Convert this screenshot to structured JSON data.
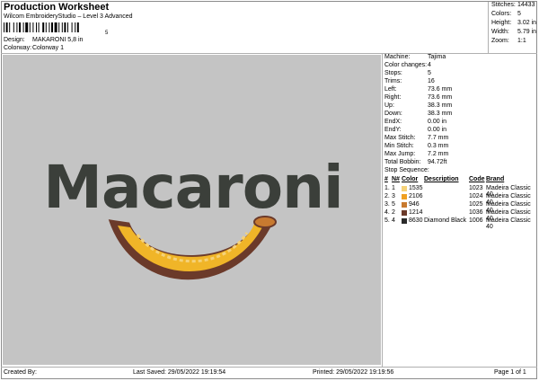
{
  "header": {
    "title": "Production Worksheet",
    "software": "Wilcom EmbroideryStudio – Level 3 Advanced",
    "barcode_digit": "5",
    "design_label": "Design:",
    "design_value": "MAKARONI 5,8 in",
    "colorway_label": "Colorway:",
    "colorway_value": "Colorway 1"
  },
  "stats": [
    {
      "label": "Stitches:",
      "value": "14433"
    },
    {
      "label": "Colors:",
      "value": "5"
    },
    {
      "label": "Height:",
      "value": "3.02 in"
    },
    {
      "label": "Width:",
      "value": "5.79 in"
    },
    {
      "label": "Zoom:",
      "value": "1:1"
    }
  ],
  "design_preview": {
    "text": "Macaroni",
    "text_color": "#3b3f3a",
    "background": "#c4c4c4",
    "pasta_color": "#f0b528",
    "outline_color": "#6b3a2a"
  },
  "machine_info": [
    {
      "label": "Machine:",
      "value": "Tajima"
    },
    {
      "label": "Color changes:",
      "value": "4"
    },
    {
      "label": "Stops:",
      "value": "5"
    },
    {
      "label": "Trims:",
      "value": "16"
    },
    {
      "label": "Left:",
      "value": "73.6 mm"
    },
    {
      "label": "Right:",
      "value": "73.6 mm"
    },
    {
      "label": "Up:",
      "value": "38.3 mm"
    },
    {
      "label": "Down:",
      "value": "38.3 mm"
    },
    {
      "label": "EndX:",
      "value": "0.00 in"
    },
    {
      "label": "EndY:",
      "value": "0.00 in"
    },
    {
      "label": "Max Stitch:",
      "value": "7.7 mm"
    },
    {
      "label": "Min Stitch:",
      "value": "0.3 mm"
    },
    {
      "label": "Max Jump:",
      "value": "7.2 mm"
    },
    {
      "label": "Total Bobbin:",
      "value": "94.72ft"
    }
  ],
  "stop_sequence": {
    "title": "Stop Sequence:",
    "headers": {
      "num": "#",
      "needle": "N#",
      "color": "Color",
      "description": "Description",
      "code": "Code",
      "brand": "Brand"
    },
    "rows": [
      {
        "num": "1.",
        "needle": "1",
        "swatch": "#f5d27a",
        "color": "1535",
        "description": "",
        "code": "1023",
        "brand": "Madeira Classic 40"
      },
      {
        "num": "2.",
        "needle": "3",
        "swatch": "#f0a020",
        "color": "2106",
        "description": "",
        "code": "1024",
        "brand": "Madeira Classic 40"
      },
      {
        "num": "3.",
        "needle": "5",
        "swatch": "#c87a30",
        "color": "946",
        "description": "",
        "code": "1025",
        "brand": "Madeira Classic 40"
      },
      {
        "num": "4.",
        "needle": "2",
        "swatch": "#6b3a2a",
        "color": "1214",
        "description": "",
        "code": "1036",
        "brand": "Madeira Classic 40"
      },
      {
        "num": "5.",
        "needle": "4",
        "swatch": "#2a2a2a",
        "color": "8630",
        "description": "Diamond Black",
        "code": "1006",
        "brand": "Madeira Classic 40"
      }
    ]
  },
  "footer": {
    "created_by": "Created By:",
    "last_saved": "Last Saved: 29/05/2022 19:19:54",
    "printed": "Printed: 29/05/2022 19:19:56",
    "page": "Page 1 of 1"
  }
}
